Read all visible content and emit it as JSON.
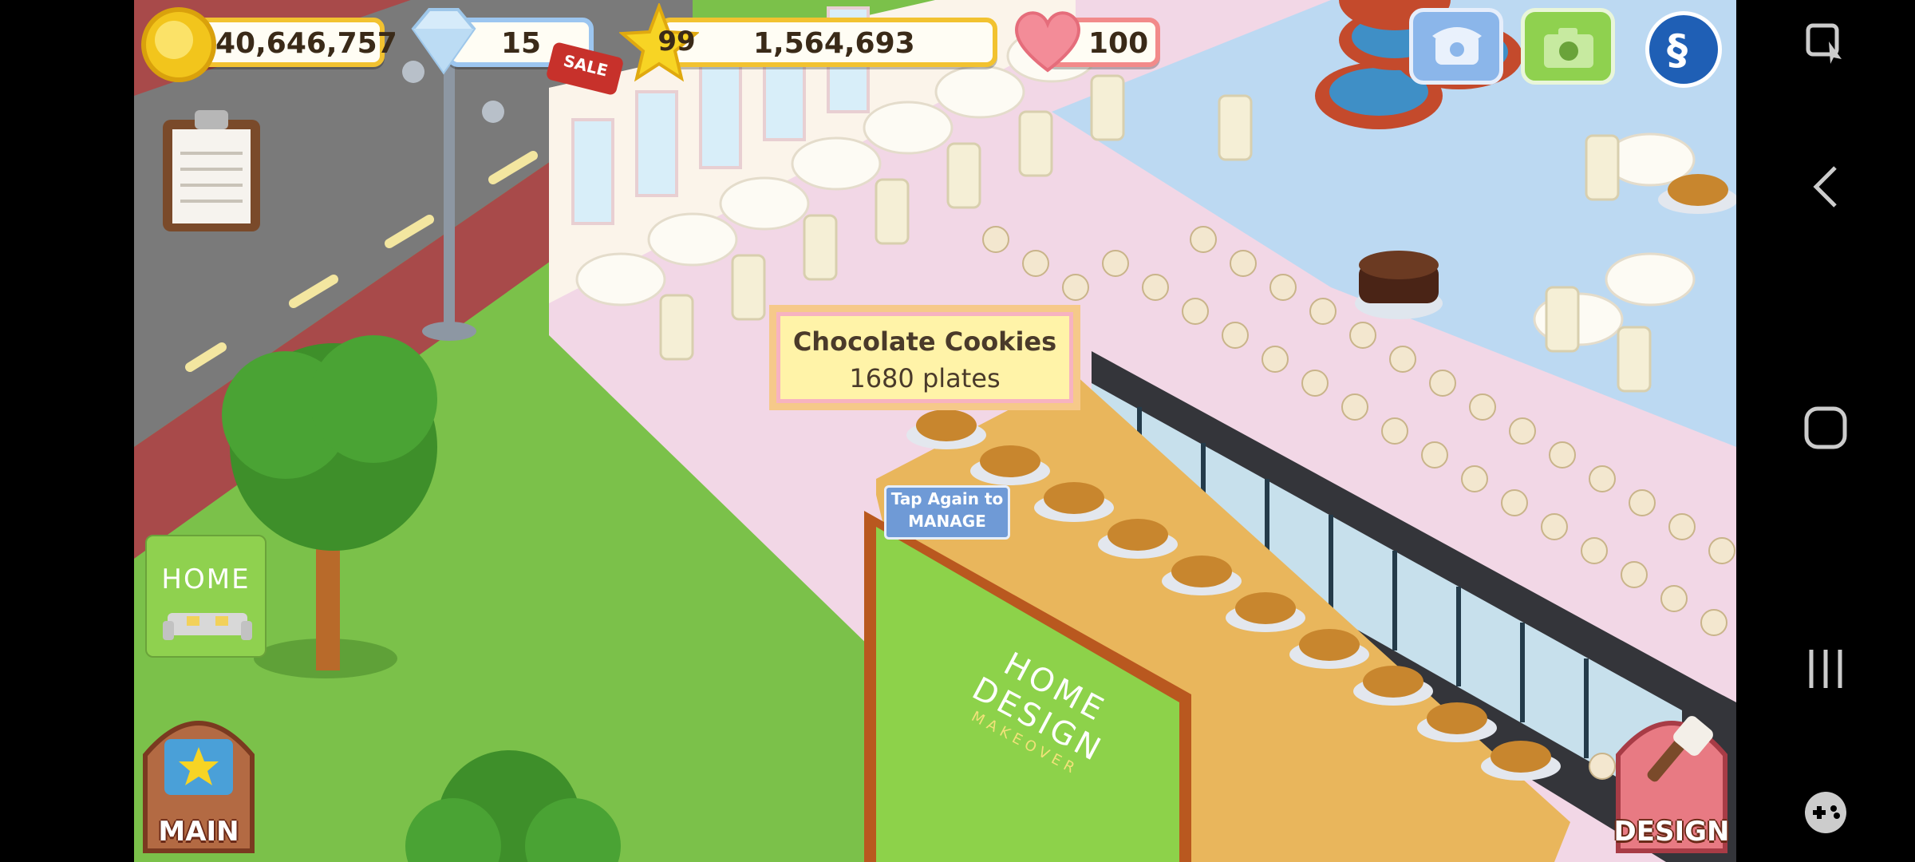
{
  "hud": {
    "coins": "40,646,757",
    "gems": "15",
    "sale_badge": "SALE",
    "level": "99",
    "xp": "1,564,693",
    "hearts": "100"
  },
  "tooltip": {
    "item_name": "Chocolate Cookies",
    "quantity": "1680 plates"
  },
  "tap_hint": {
    "line1": "Tap Again to",
    "line2": "MANAGE"
  },
  "buttons": {
    "home": "HOME",
    "main": "MAIN",
    "design": "DESIGN"
  },
  "billboard": {
    "line1": "HOME",
    "line2": "DESIGN",
    "line3": "MAKEOVER"
  },
  "icons": {
    "coin": "coin-icon",
    "gem": "diamond-icon",
    "star": "star-icon",
    "heart": "heart-icon",
    "phone": "phone-icon",
    "camera": "camera-icon",
    "social": "social-icon",
    "clipboard": "clipboard-icon"
  },
  "colors": {
    "grass": "#7bc14a",
    "coin_border": "#f2c230",
    "gem_border": "#9cc6f0",
    "heart_border": "#f28a8a",
    "tooltip_bg": "#fff3a8"
  }
}
